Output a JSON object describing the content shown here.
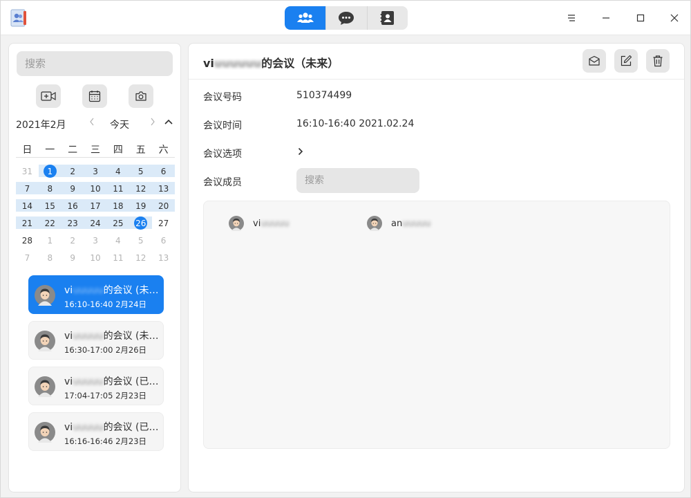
{
  "titlebar": {
    "app_icon": "app-contacts-icon",
    "views": [
      {
        "name": "meetings",
        "icon": "group-icon",
        "active": true
      },
      {
        "name": "chat",
        "icon": "chat-bubble-icon",
        "active": false
      },
      {
        "name": "contacts",
        "icon": "contact-card-icon",
        "active": false
      }
    ],
    "controls": [
      "menu-icon",
      "minimize-icon",
      "maximize-icon",
      "close-icon"
    ]
  },
  "sidebar": {
    "search_placeholder": "搜索",
    "tools": [
      "video-camera-icon",
      "calendar-icon",
      "camera-icon"
    ],
    "calendar": {
      "month_label": "2021年2月",
      "today_label": "今天",
      "weekdays": [
        "日",
        "一",
        "二",
        "三",
        "四",
        "五",
        "六"
      ],
      "weeks": [
        [
          "31",
          "1",
          "2",
          "3",
          "4",
          "5",
          "6"
        ],
        [
          "7",
          "8",
          "9",
          "10",
          "11",
          "12",
          "13"
        ],
        [
          "14",
          "15",
          "16",
          "17",
          "18",
          "19",
          "20"
        ],
        [
          "21",
          "22",
          "23",
          "24",
          "25",
          "26",
          "27"
        ],
        [
          "28",
          "1",
          "2",
          "3",
          "4",
          "5",
          "6"
        ],
        [
          "7",
          "8",
          "9",
          "10",
          "11",
          "12",
          "13"
        ]
      ],
      "selected": [
        "1",
        "26"
      ],
      "accent": "#1a80f0",
      "highlight": "#dbeaf8"
    },
    "meetings": [
      {
        "prefix": "vi",
        "suffix": "的会议 (未来)",
        "time": "16:10-16:40  2月24日",
        "active": true
      },
      {
        "prefix": "vi",
        "suffix": "的会议 (未来)",
        "time": "16:30-17:00  2月26日",
        "active": false
      },
      {
        "prefix": "vi",
        "suffix": "的会议 (已结束)",
        "time": "17:04-17:05  2月23日",
        "active": false
      },
      {
        "prefix": "vi",
        "suffix": "的会议 (已结束)",
        "time": "16:16-16:46  2月23日",
        "active": false
      }
    ]
  },
  "detail": {
    "title_prefix": "vi",
    "title_suffix": "的会议（未来）",
    "actions": [
      "mail-icon",
      "edit-icon",
      "trash-icon"
    ],
    "fields": {
      "number_label": "会议号码",
      "number_value": "510374499",
      "time_label": "会议时间",
      "time_value": "16:10-16:40  2021.02.24",
      "options_label": "会议选项",
      "members_label": "会议成员"
    },
    "member_search_placeholder": "搜索",
    "members": [
      {
        "prefix": "vi"
      },
      {
        "prefix": "an"
      }
    ]
  }
}
